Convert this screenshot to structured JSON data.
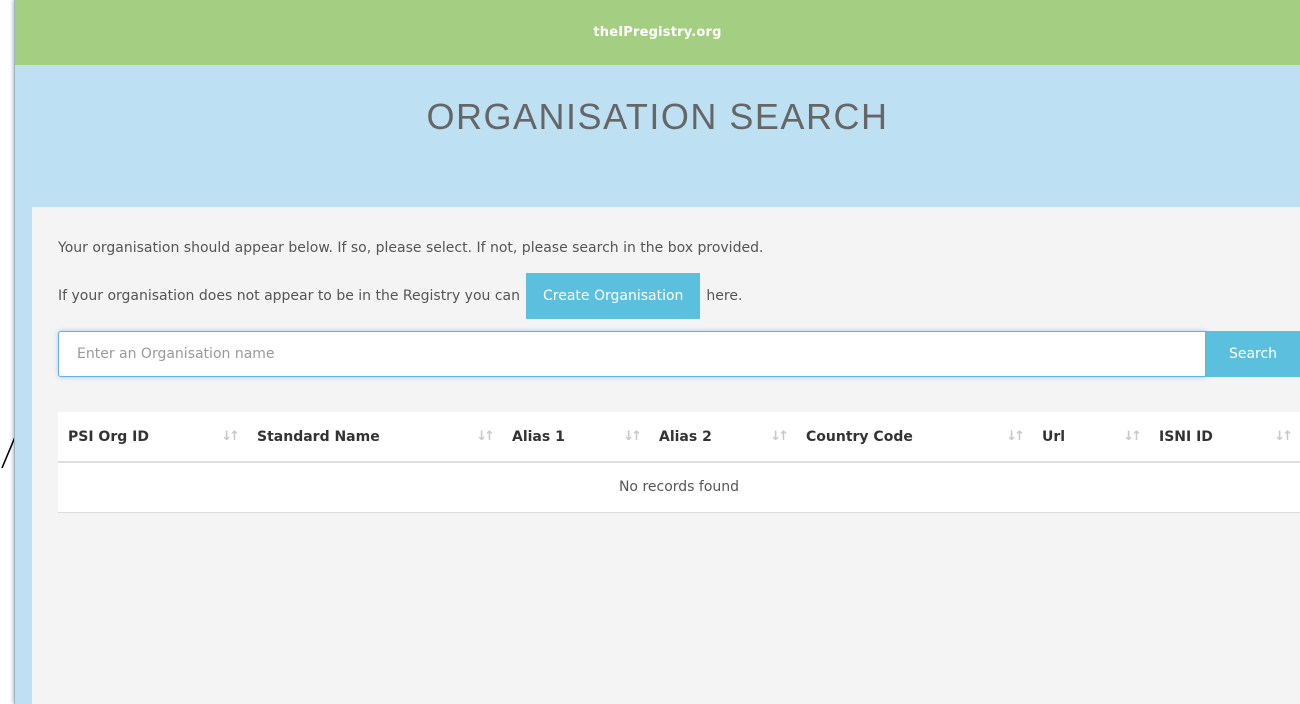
{
  "header": {
    "site_name": "theIPregistry.org"
  },
  "page": {
    "title": "ORGANISATION SEARCH"
  },
  "intro": {
    "line1": "Your organisation should appear below. If so, please select. If not, please search in the box provided.",
    "line2_before": "If your organisation does not appear to be in the Registry you can",
    "create_button": "Create Organisation",
    "line2_after": "here."
  },
  "search": {
    "placeholder": "Enter an Organisation name",
    "value": "",
    "button_label": "Search"
  },
  "table": {
    "columns": [
      "PSI Org ID",
      "Standard Name",
      "Alias 1",
      "Alias 2",
      "Country Code",
      "Url",
      "ISNI ID"
    ],
    "sort_icon": "sort-arrows-icon",
    "empty_message": "No records found"
  },
  "colors": {
    "topbar": "#a4cf82",
    "band": "#bde0f2",
    "accent": "#5bc0de"
  }
}
